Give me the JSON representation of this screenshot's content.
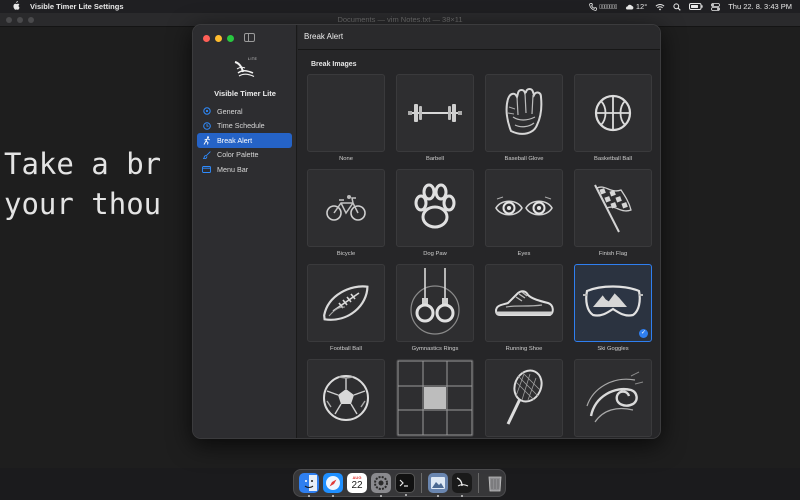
{
  "menubar": {
    "app_name": "Visible Timer Lite Settings",
    "input_source": "▯▯▯▯▯▯▯",
    "temperature": "12°",
    "datetime": "Thu 22. 8.  3:43 PM"
  },
  "terminal": {
    "title": "Documents — vim Notes.txt — 38×11",
    "line1": "Take a br                        ed",
    "line2": "your thou"
  },
  "settings": {
    "app_name": "Visible Timer Lite",
    "logo_text": "LITE",
    "nav": [
      {
        "label": "General",
        "icon": "gear-icon",
        "active": false
      },
      {
        "label": "Time Schedule",
        "icon": "clock-icon",
        "active": false
      },
      {
        "label": "Break Alert",
        "icon": "runner-icon",
        "active": true
      },
      {
        "label": "Color Palette",
        "icon": "brush-icon",
        "active": false
      },
      {
        "label": "Menu Bar",
        "icon": "menubar-icon",
        "active": false
      }
    ],
    "content_title": "Break Alert",
    "section_title": "Break Images",
    "images": [
      {
        "label": "None",
        "icon": "none"
      },
      {
        "label": "Barbell",
        "icon": "barbell-icon"
      },
      {
        "label": "Baseball Glove",
        "icon": "baseball-glove-icon"
      },
      {
        "label": "Basketball Ball",
        "icon": "basketball-icon"
      },
      {
        "label": "Bicycle",
        "icon": "bicycle-icon"
      },
      {
        "label": "Dog Paw",
        "icon": "dog-paw-icon"
      },
      {
        "label": "Eyes",
        "icon": "eyes-icon"
      },
      {
        "label": "Finish Flag",
        "icon": "finish-flag-icon"
      },
      {
        "label": "Football Ball",
        "icon": "football-icon"
      },
      {
        "label": "Gymnastics Rings",
        "icon": "gymnastics-rings-icon"
      },
      {
        "label": "Running Shoe",
        "icon": "running-shoe-icon"
      },
      {
        "label": "Ski Goggles",
        "icon": "ski-goggles-icon",
        "selected": true
      },
      {
        "label": "",
        "icon": "soccer-ball-icon"
      },
      {
        "label": "",
        "icon": "grid-pattern-icon"
      },
      {
        "label": "",
        "icon": "tennis-racket-icon"
      },
      {
        "label": "",
        "icon": "swirl-icon"
      }
    ]
  },
  "dock": {
    "calendar_month": "AUG",
    "calendar_day": "22"
  },
  "colors": {
    "accent": "#2563c7",
    "selected_border": "#2f7ff0"
  }
}
